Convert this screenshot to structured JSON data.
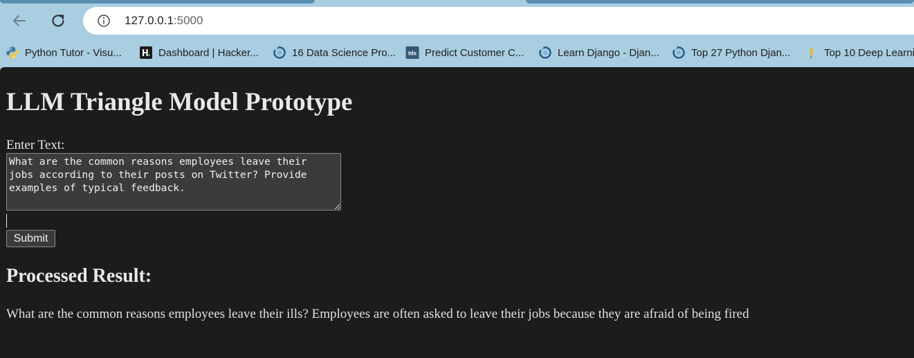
{
  "browser": {
    "url_host": "127.0.0.1",
    "url_port": ":5000",
    "bookmarks": [
      {
        "label": "Python Tutor - Visu...",
        "icon": "python-icon"
      },
      {
        "label": "Dashboard | Hacker...",
        "icon": "hackerrank-icon"
      },
      {
        "label": "16 Data Science Pro...",
        "icon": "globe-loop-icon"
      },
      {
        "label": "Predict Customer C...",
        "icon": "tds-icon"
      },
      {
        "label": "Learn Django - Djan...",
        "icon": "globe-loop-icon"
      },
      {
        "label": "Top 27 Python Djan...",
        "icon": "globe-loop-icon"
      },
      {
        "label": "Top 10 Deep Learni...",
        "icon": "feather-icon"
      }
    ],
    "tds_badge": "tds"
  },
  "page": {
    "title": "LLM Triangle Model Prototype",
    "input_label": "Enter Text:",
    "input_value": "What are the common reasons employees leave their\njobs according to their posts on Twitter? Provide\nexamples of typical feedback.",
    "submit_label": "Submit",
    "result_heading": "Processed Result:",
    "result_text": "What are the common reasons employees leave their ills? Employees are often asked to leave their jobs because they are afraid of being fired"
  },
  "colors": {
    "chrome_bg": "#a9cde1",
    "page_bg": "#1b1c1e",
    "control_bg": "#3b3b3b"
  }
}
